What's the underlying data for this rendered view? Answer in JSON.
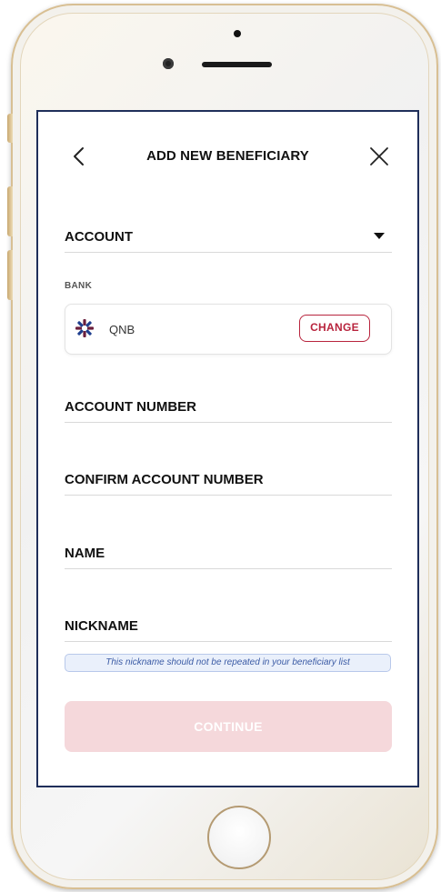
{
  "header": {
    "title": "ADD NEW BENEFICIARY",
    "back_icon": "chevron-left-icon",
    "close_icon": "close-icon"
  },
  "form": {
    "account_label": "ACCOUNT",
    "bank_label": "BANK",
    "bank_name": "QNB",
    "change_label": "CHANGE",
    "account_number_label": "ACCOUNT NUMBER",
    "confirm_account_number_label": "CONFIRM ACCOUNT NUMBER",
    "name_label": "NAME",
    "nickname_label": "NICKNAME",
    "nickname_hint": "This nickname should not be repeated in your beneficiary list",
    "continue_label": "CONTINUE"
  },
  "colors": {
    "accent": "#b8243d",
    "button_disabled": "#f5d8db",
    "hint_bg": "#eaf0fb",
    "hint_text": "#3b5ba5",
    "bank_logo_primary": "#6b1f3d",
    "bank_logo_secondary": "#1f3f8f"
  }
}
